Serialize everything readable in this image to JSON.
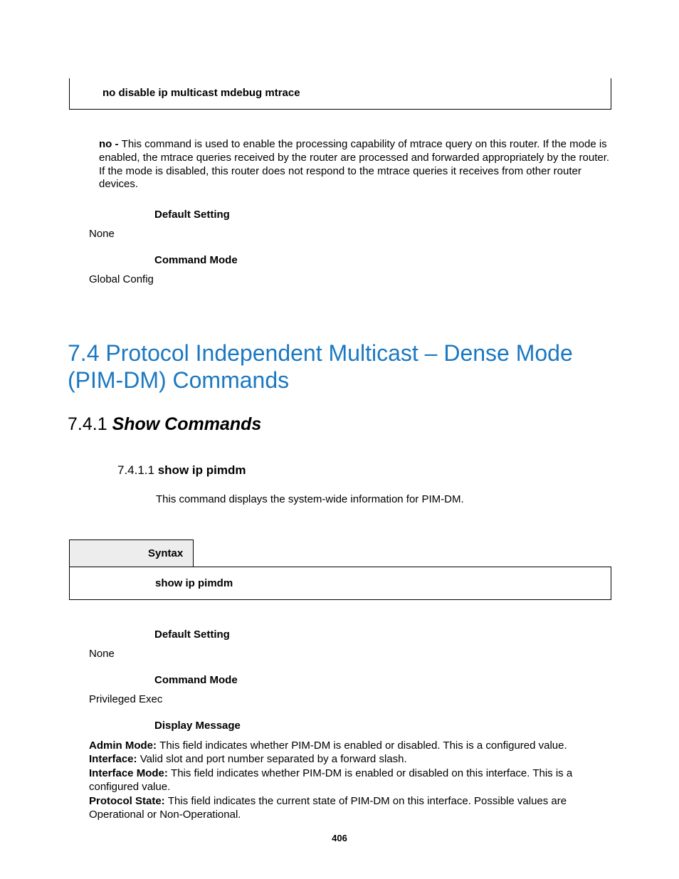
{
  "top_syntax_cmd": "no disable ip multicast mdebug mtrace",
  "no_label": "no - ",
  "no_desc": "This command is used to enable the processing capability of mtrace query on this router. If the mode is enabled, the mtrace queries received by the router are processed and forwarded appropriately by the router. If the mode is disabled, this router does not respond to the mtrace queries it receives from other router devices.",
  "labels": {
    "default_setting": "Default Setting",
    "command_mode": "Command Mode",
    "display_message": "Display Message",
    "syntax": "Syntax"
  },
  "sec1": {
    "default_setting_value": "None",
    "command_mode_value": "Global Config"
  },
  "h1": "7.4 Protocol Independent Multicast – Dense Mode (PIM-DM) Commands",
  "h2_num": "7.4.1 ",
  "h2_title": "Show Commands",
  "h3_num": "7.4.1.1 ",
  "h3_title": "show ip pimdm",
  "h3_desc": "This command displays the system-wide information for PIM-DM.",
  "syntax_cmd": "show ip pimdm",
  "sec2": {
    "default_setting_value": "None",
    "command_mode_value": "Privileged Exec"
  },
  "display": {
    "admin_mode_label": "Admin Mode: ",
    "admin_mode_text": "This field indicates whether PIM-DM is enabled or disabled. This is a configured value.",
    "interface_label": "Interface: ",
    "interface_text": "Valid slot and port number separated by a forward slash.",
    "interface_mode_label": "Interface Mode: ",
    "interface_mode_text": "This field indicates whether PIM-DM is enabled or disabled on this interface. This is a configured value.",
    "protocol_state_label": "Protocol State: ",
    "protocol_state_text": "This field indicates the current state of PIM-DM on this interface. Possible values are Operational or Non-Operational."
  },
  "page_number": "406"
}
